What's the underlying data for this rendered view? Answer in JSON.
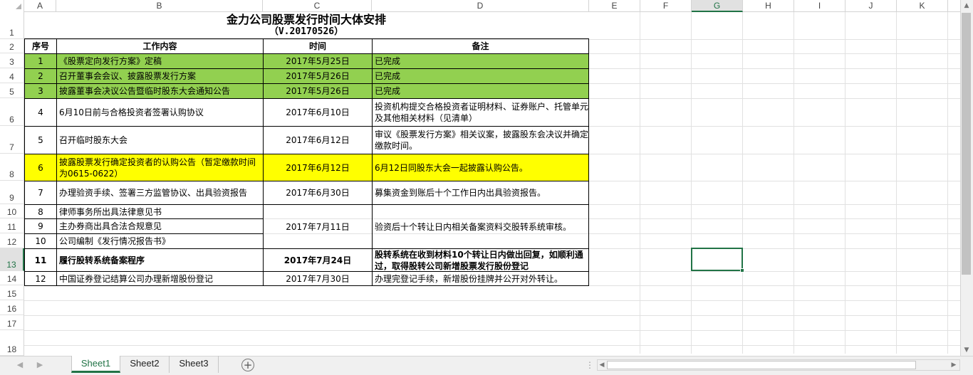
{
  "columns": [
    "A",
    "B",
    "C",
    "D",
    "E",
    "F",
    "G",
    "H",
    "I",
    "J",
    "K"
  ],
  "selected_column": "G",
  "rows": [
    "1",
    "2",
    "3",
    "4",
    "5",
    "6",
    "7",
    "8",
    "9",
    "10",
    "11",
    "12",
    "13",
    "14",
    "15",
    "16",
    "17",
    "18"
  ],
  "selected_row": "13",
  "title": "金力公司股票发行时间大体安排",
  "subtitle": "（V.20170526）",
  "headers": {
    "seq": "序号",
    "work": "工作内容",
    "time": "时间",
    "note": "备注"
  },
  "tasks": [
    {
      "seq": "1",
      "work": "《股票定向发行方案》定稿",
      "time": "2017年5月25日",
      "note": "已完成"
    },
    {
      "seq": "2",
      "work": "召开董事会会议、披露股票发行方案",
      "time": "2017年5月26日",
      "note": "已完成"
    },
    {
      "seq": "3",
      "work": "披露董事会决议公告暨临时股东大会通知公告",
      "time": "2017年5月26日",
      "note": "已完成"
    },
    {
      "seq": "4",
      "work": "6月10日前与合格投资者签署认购协议",
      "time": "2017年6月10日",
      "note": "投资机构提交合格投资者证明材料、证券账户、托管单元及其他相关材料（见清单）"
    },
    {
      "seq": "5",
      "work": "召开临时股东大会",
      "time": "2017年6月12日",
      "note": "审议《股票发行方案》相关议案，披露股东会决议并确定缴款时间。"
    },
    {
      "seq": "6",
      "work": "披露股票发行确定投资者的认购公告（暂定缴款时间为0615-0622）",
      "time": "2017年6月12日",
      "note": "6月12日同股东大会一起披露认购公告。"
    },
    {
      "seq": "7",
      "work": "办理验资手续、签署三方监管协议、出具验资报告",
      "time": "2017年6月30日",
      "note": "募集资金到账后十个工作日内出具验资报告。"
    },
    {
      "seq": "8",
      "work": "律师事务所出具法律意见书"
    },
    {
      "seq": "9",
      "work": "主办券商出具合法合规意见"
    },
    {
      "seq": "10",
      "work": "公司编制《发行情况报告书》"
    },
    {
      "seq": "11",
      "work": "履行股转系统备案程序",
      "time": "2017年7月24日",
      "note": "股转系统在收到材料10个转让日内做出回复，如顺利通过，取得股转公司新增股票发行股份登记"
    },
    {
      "seq": "12",
      "work": "中国证券登记结算公司办理新增股份登记",
      "time": "2017年7月30日",
      "note": "办理完登记手续，新增股份挂牌并公开对外转让。"
    }
  ],
  "merged_8_10": {
    "time": "2017年7月11日",
    "note": "验资后十个转让日内相关备案资料交股转系统审核。"
  },
  "sheets": [
    "Sheet1",
    "Sheet2",
    "Sheet3"
  ],
  "active_sheet": "Sheet1",
  "colors": {
    "green": "#92d050",
    "yellow": "#ffff00",
    "accent": "#217346"
  },
  "icons": {
    "prev": "prev-sheet-icon",
    "next": "next-sheet-icon",
    "add": "add-sheet-icon"
  }
}
